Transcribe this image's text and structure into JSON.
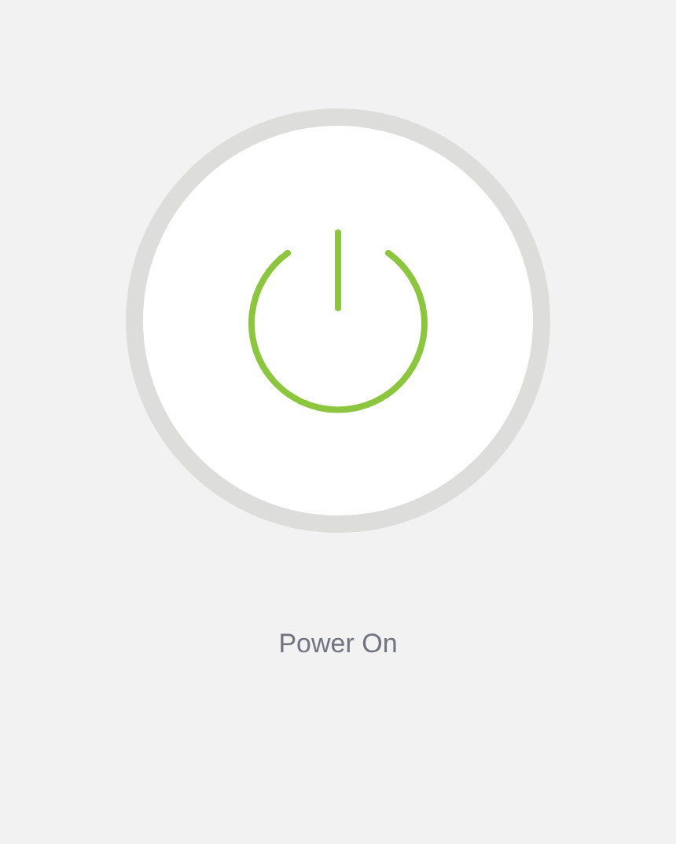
{
  "power_button": {
    "on": true
  },
  "status_label": "Power On"
}
